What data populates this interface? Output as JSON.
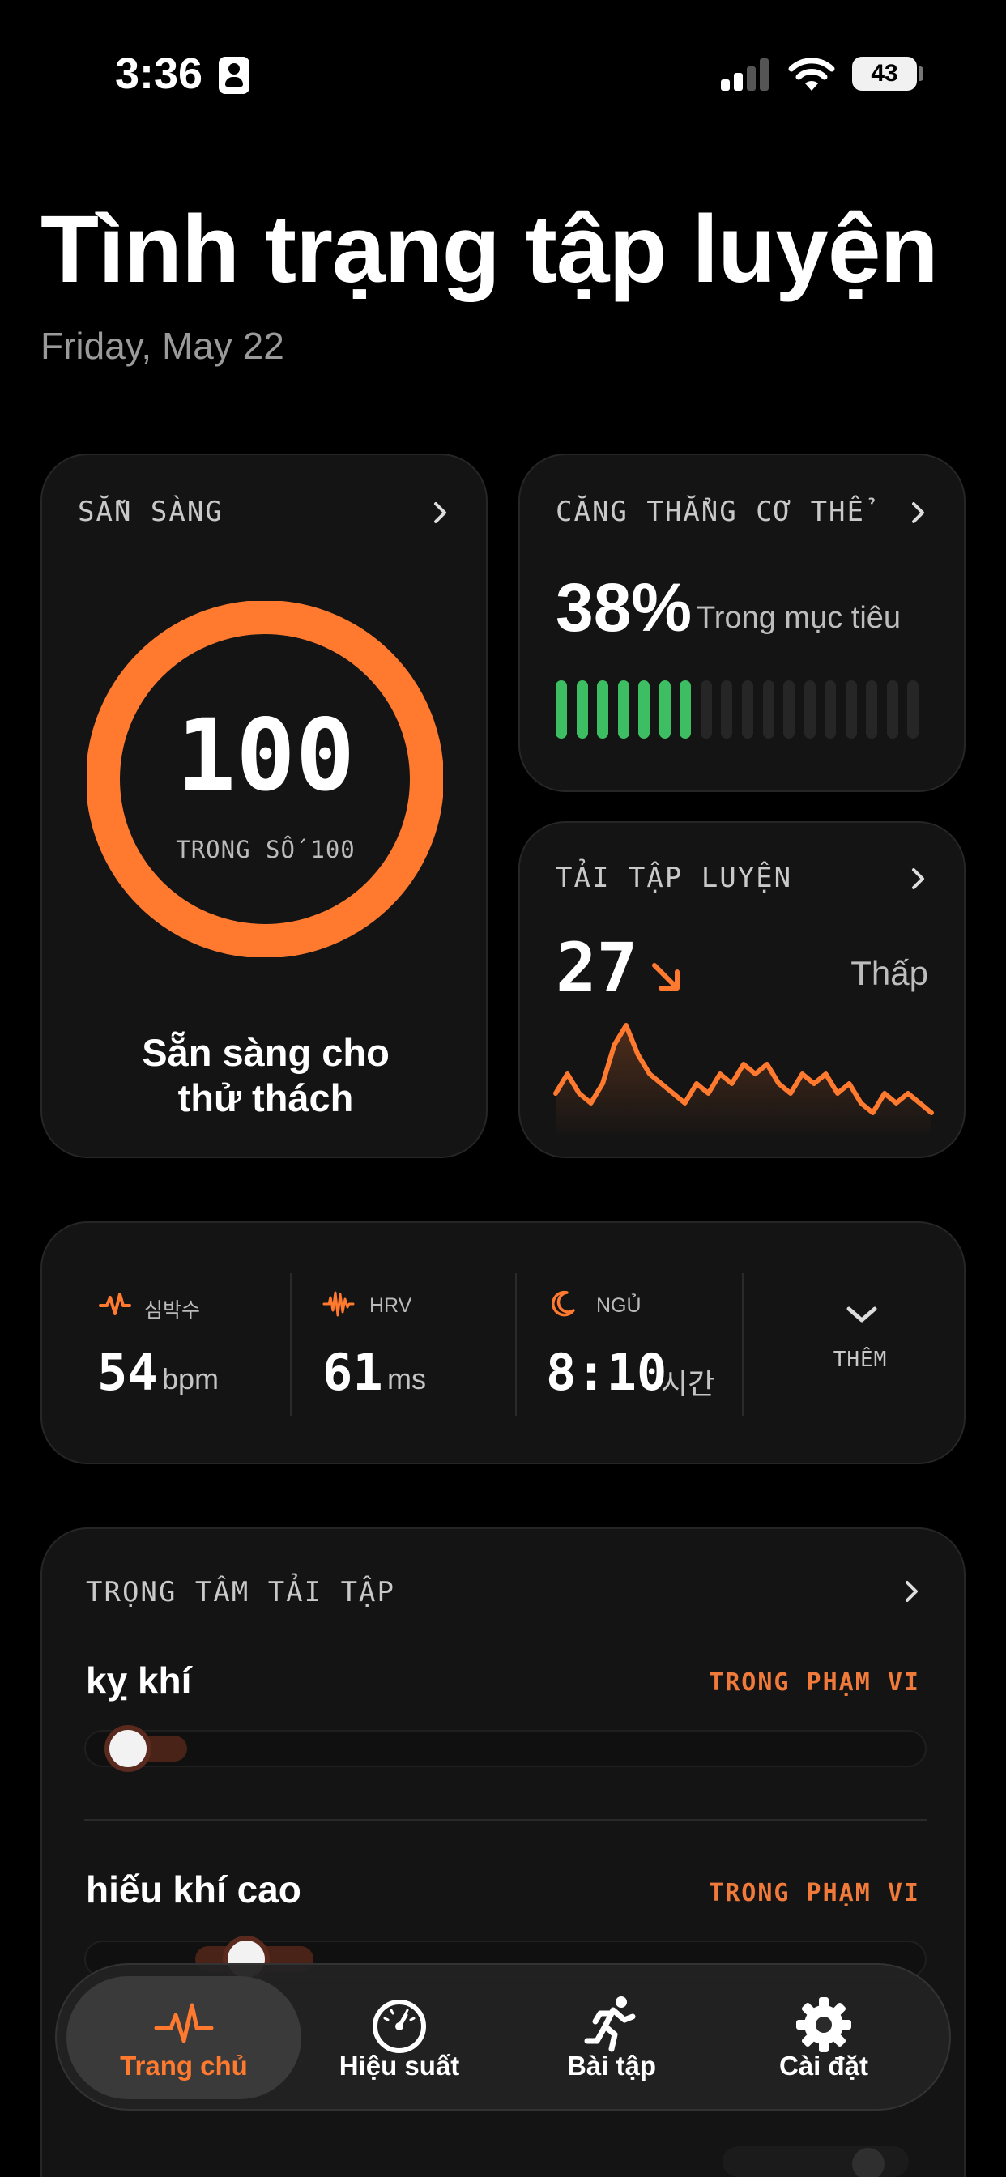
{
  "status_bar": {
    "time": "3:36",
    "battery": "43"
  },
  "header": {
    "title": "Tình trạng tập luyện",
    "date": "Friday, May 22"
  },
  "readiness": {
    "label": "SẴN SÀNG",
    "score": "100",
    "out_of": "TRONG SỐ 100",
    "fraction": 1.0,
    "message_line1": "Sẵn sàng cho",
    "message_line2": "thử thách",
    "ring_color": "#ff7a2f"
  },
  "strain": {
    "label": "CĂNG THẲNG CƠ THỂ",
    "percent": "38%",
    "note": "Trong mục tiêu",
    "filled_segments": 7,
    "total_segments": 18,
    "fill_color": "#3dbe62"
  },
  "load": {
    "label": "TẢI TẬP LUYỆN",
    "value": "27",
    "level": "Thấp",
    "trend": "down",
    "line_color": "#ff7a2f",
    "trend_series": [
      3,
      5,
      3,
      2,
      4,
      8,
      10,
      7,
      5,
      4,
      3,
      2,
      4,
      3,
      5,
      4,
      6,
      5,
      6,
      4,
      3,
      5,
      4,
      5,
      3,
      4,
      2,
      1,
      3,
      2,
      3,
      2,
      1
    ]
  },
  "vitals": {
    "heart_rate": {
      "label": "심박수",
      "value": "54",
      "unit": "bpm"
    },
    "hrv": {
      "label": "HRV",
      "value": "61",
      "unit": "ms"
    },
    "sleep": {
      "label": "NGỦ",
      "value": "8:10",
      "unit": "시간"
    },
    "more_label": "THÊM"
  },
  "focus": {
    "label": "TRỌNG TÂM TẢI TẬP",
    "rows": [
      {
        "name": "kỵ khí",
        "status": "TRONG PHẠM VI",
        "range_start": 0.04,
        "range_end": 0.12,
        "value": 0.05
      },
      {
        "name": "hiếu khí cao",
        "status": "TRONG PHẠM VI",
        "range_start": 0.13,
        "range_end": 0.27,
        "value": 0.19
      }
    ]
  },
  "tabbar": {
    "items": [
      {
        "label": "Trang chủ",
        "icon": "heartbeat-icon",
        "active": true
      },
      {
        "label": "Hiệu suất",
        "icon": "gauge-icon",
        "active": false
      },
      {
        "label": "Bài tập",
        "icon": "running-icon",
        "active": false
      },
      {
        "label": "Cài đặt",
        "icon": "gear-icon",
        "active": false
      }
    ],
    "active_color": "#ff7a2f"
  }
}
